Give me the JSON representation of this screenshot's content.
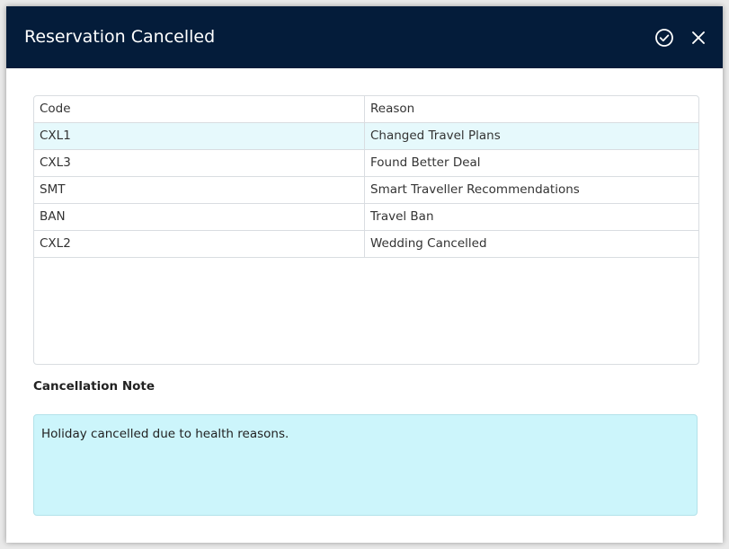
{
  "dialog": {
    "title": "Reservation Cancelled",
    "confirm_icon": "check-circle-icon",
    "close_icon": "close-icon"
  },
  "table": {
    "columns": [
      "Code",
      "Reason"
    ],
    "rows": [
      {
        "code": "CXL1",
        "reason": "Changed Travel Plans",
        "selected": true
      },
      {
        "code": "CXL3",
        "reason": "Found Better Deal",
        "selected": false
      },
      {
        "code": "SMT",
        "reason": "Smart Traveller Recommendations",
        "selected": false
      },
      {
        "code": "BAN",
        "reason": "Travel Ban",
        "selected": false
      },
      {
        "code": "CXL2",
        "reason": "Wedding Cancelled",
        "selected": false
      }
    ]
  },
  "note": {
    "label": "Cancellation Note",
    "value": "Holiday cancelled due to health reasons."
  },
  "colors": {
    "header_bg": "#041c3a",
    "selected_row_bg": "#e6f9fc",
    "note_bg": "#ccf5fb"
  }
}
